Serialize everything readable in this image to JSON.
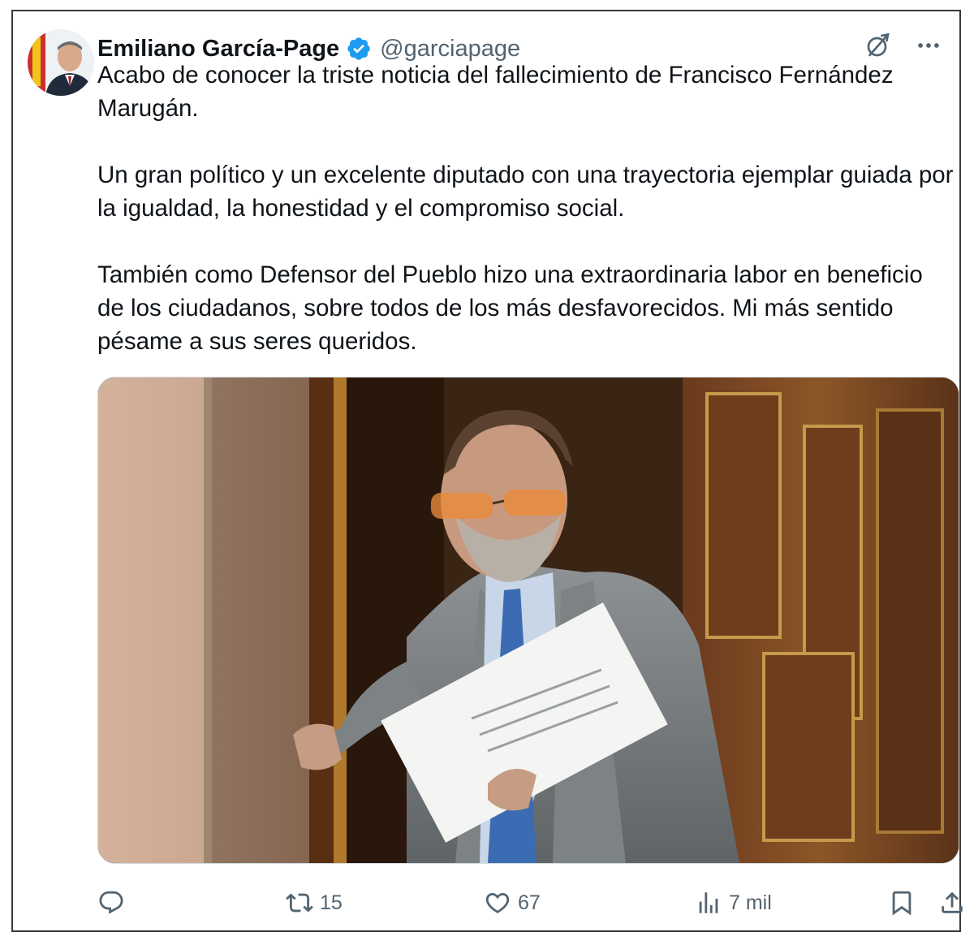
{
  "tweet": {
    "author_name": "Emiliano García-Page",
    "author_handle": "@garciapage",
    "paragraphs": [
      "Acabo de conocer la triste noticia del fallecimiento de Francisco Fernández Marugán.",
      "Un gran político y un excelente diputado con una trayectoria ejemplar guiada por la igualdad, la honestidad y el compromiso social.",
      "También como Defensor del Pueblo hizo una extraordinaria labor en beneficio de los ciudadanos, sobre todos de los más desfavorecidos. Mi más sentido pésame a sus seres queridos."
    ],
    "verified": true
  },
  "icons": {
    "verified": "verified-badge-icon",
    "grok": "grok-icon",
    "more": "more-icon",
    "reply": "reply-icon",
    "retweet": "retweet-icon",
    "like": "like-icon",
    "views": "views-icon",
    "bookmark": "bookmark-icon",
    "share": "share-icon"
  },
  "engagement": {
    "retweets": "15",
    "likes": "67",
    "views": "7 mil"
  },
  "colors": {
    "text": "#0f1419",
    "secondary": "#536471",
    "verified_blue": "#1d9bf0"
  }
}
